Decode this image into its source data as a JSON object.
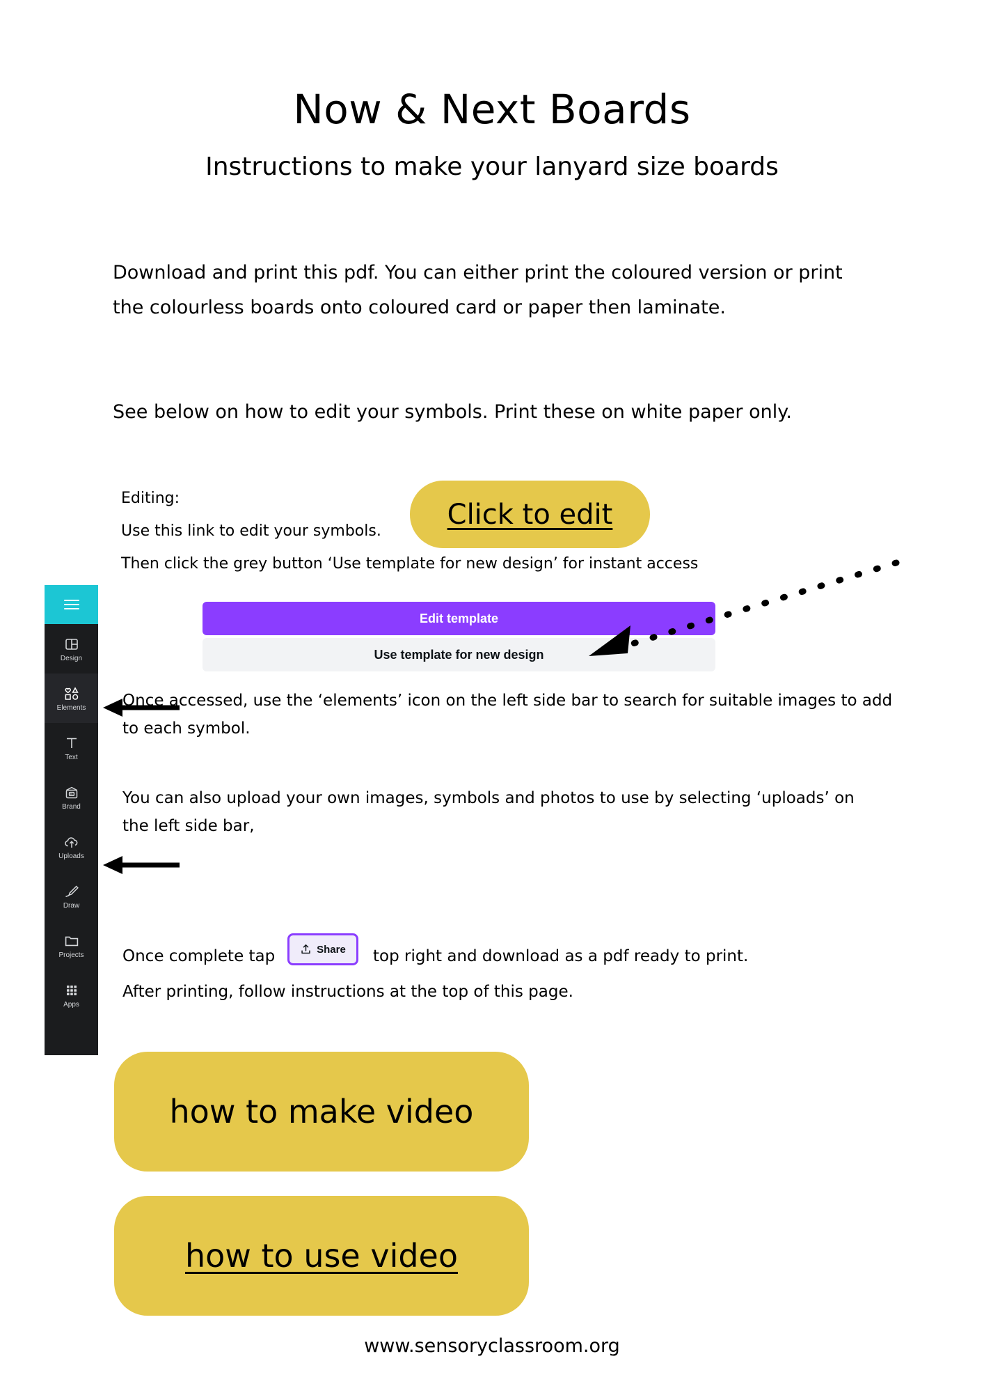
{
  "document": {
    "title": "Now & Next Boards",
    "subtitle": "Instructions to make your lanyard size boards",
    "footer_url": "www.sensoryclassroom.org"
  },
  "intro": {
    "paragraph_1": "Download and print this pdf. You can either print the coloured version or print the colourless boards onto coloured card or paper then laminate.",
    "paragraph_2": "See below on how to edit your symbols. Print these on white paper only."
  },
  "editing": {
    "label": "Editing:",
    "line_2": "Use this link to edit your symbols.",
    "line_3": "Then click the grey button ‘Use template for new design’ for instant access",
    "click_to_edit_label": "Click to edit"
  },
  "canva_template_buttons": {
    "edit_template_label": "Edit template",
    "use_template_label": "Use template for new design"
  },
  "canva_sidebar": {
    "hamburger_icon": "hamburger-menu-icon",
    "items": [
      {
        "label": "Design",
        "icon": "design-layout-icon",
        "active": false
      },
      {
        "label": "Elements",
        "icon": "elements-shapes-icon",
        "active": true
      },
      {
        "label": "Text",
        "icon": "text-t-icon",
        "active": false
      },
      {
        "label": "Brand",
        "icon": "brand-wallet-icon",
        "active": false
      },
      {
        "label": "Uploads",
        "icon": "cloud-upload-icon",
        "active": false
      },
      {
        "label": "Draw",
        "icon": "draw-pen-icon",
        "active": false
      },
      {
        "label": "Projects",
        "icon": "folder-icon",
        "active": false
      },
      {
        "label": "Apps",
        "icon": "apps-grid-icon",
        "active": false
      }
    ]
  },
  "instructions": {
    "elements": "Once accessed,  use the ‘elements’ icon on the left side bar to search for suitable images to add to each symbol.",
    "uploads": "You can also upload your own images, symbols and photos to use by selecting ‘uploads’ on the left side bar,",
    "share_prefix": "Once complete tap",
    "share_button_label": "Share",
    "share_suffix": "top right and download as a pdf ready to print.",
    "after_printing": "After printing, follow instructions at the top of this page."
  },
  "video_buttons": {
    "how_to_make": "how to make video",
    "how_to_use": "how to use video"
  },
  "colors": {
    "yellow": "#e5c84b",
    "canva_purple": "#8b3dff",
    "canva_grey": "#f2f3f5",
    "sidebar_dark": "#1b1c1e",
    "teal": "#1cc6d4"
  }
}
